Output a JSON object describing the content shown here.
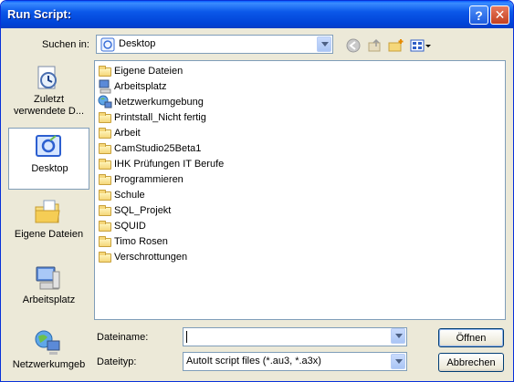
{
  "window": {
    "title": "Run Script:",
    "help_glyph": "?",
    "close_glyph": "✕"
  },
  "lookin": {
    "label": "Suchen in:",
    "value": "Desktop"
  },
  "toolbar": {
    "icons": [
      "back-icon",
      "up-folder-icon",
      "new-folder-icon",
      "view-menu-icon"
    ]
  },
  "places": [
    {
      "label": "Zuletzt verwendete D...",
      "icon": "recent-documents-icon"
    },
    {
      "label": "Desktop",
      "icon": "desktop-icon"
    },
    {
      "label": "Eigene Dateien",
      "icon": "my-documents-icon"
    },
    {
      "label": "Arbeitsplatz",
      "icon": "my-computer-icon"
    },
    {
      "label": "Netzwerkumgeb",
      "icon": "network-icon"
    }
  ],
  "files": [
    {
      "name": "Eigene Dateien",
      "icon": "folder-icon"
    },
    {
      "name": "Arbeitsplatz",
      "icon": "my-computer-icon"
    },
    {
      "name": "Netzwerkumgebung",
      "icon": "network-icon"
    },
    {
      "name": "Printstall_Nicht fertig",
      "icon": "folder-icon"
    },
    {
      "name": "Arbeit",
      "icon": "folder-icon"
    },
    {
      "name": "CamStudio25Beta1",
      "icon": "folder-icon"
    },
    {
      "name": "IHK Prüfungen IT Berufe",
      "icon": "folder-icon"
    },
    {
      "name": "Programmieren",
      "icon": "folder-icon"
    },
    {
      "name": "Schule",
      "icon": "folder-icon"
    },
    {
      "name": "SQL_Projekt",
      "icon": "folder-icon"
    },
    {
      "name": "SQUID",
      "icon": "folder-icon"
    },
    {
      "name": "Timo Rosen",
      "icon": "folder-icon"
    },
    {
      "name": "Verschrottungen",
      "icon": "folder-icon"
    }
  ],
  "filename": {
    "label": "Dateiname:",
    "value": ""
  },
  "filetype": {
    "label": "Dateityp:",
    "value": "AutoIt script files (*.au3, *.a3x)"
  },
  "buttons": {
    "open": "Öffnen",
    "cancel": "Abbrechen"
  },
  "colors": {
    "title_bar": "#0054e3",
    "dialog_bg": "#ece9d8",
    "close_button": "#d9512c"
  }
}
